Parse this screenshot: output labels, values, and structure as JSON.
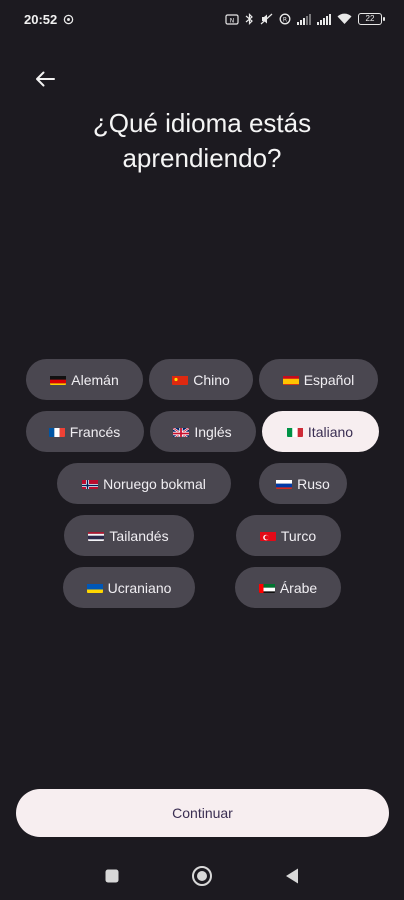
{
  "status_bar": {
    "time": "20:52",
    "battery_level": "22"
  },
  "header": {
    "title": "¿Qué idioma estás aprendiendo?"
  },
  "languages": [
    {
      "label": "Alemán",
      "flag": "flag-germany-icon",
      "selected": false
    },
    {
      "label": "Chino",
      "flag": "flag-china-icon",
      "selected": false
    },
    {
      "label": "Español",
      "flag": "flag-spain-icon",
      "selected": false
    },
    {
      "label": "Francés",
      "flag": "flag-france-icon",
      "selected": false
    },
    {
      "label": "Inglés",
      "flag": "flag-uk-icon",
      "selected": false
    },
    {
      "label": "Italiano",
      "flag": "flag-italy-icon",
      "selected": true
    },
    {
      "label": "Noruego bokmal",
      "flag": "flag-norway-icon",
      "selected": false
    },
    {
      "label": "Ruso",
      "flag": "flag-russia-icon",
      "selected": false
    },
    {
      "label": "Tailandés",
      "flag": "flag-thailand-icon",
      "selected": false
    },
    {
      "label": "Turco",
      "flag": "flag-turkey-icon",
      "selected": false
    },
    {
      "label": "Ucraniano",
      "flag": "flag-ukraine-icon",
      "selected": false
    },
    {
      "label": "Árabe",
      "flag": "flag-uae-icon",
      "selected": false
    }
  ],
  "footer": {
    "continue_label": "Continuar"
  },
  "colors": {
    "background": "#1c1a20",
    "chip": "#4a4750",
    "chip_selected": "#f7eef0",
    "accent_text": "#3a2e52"
  }
}
